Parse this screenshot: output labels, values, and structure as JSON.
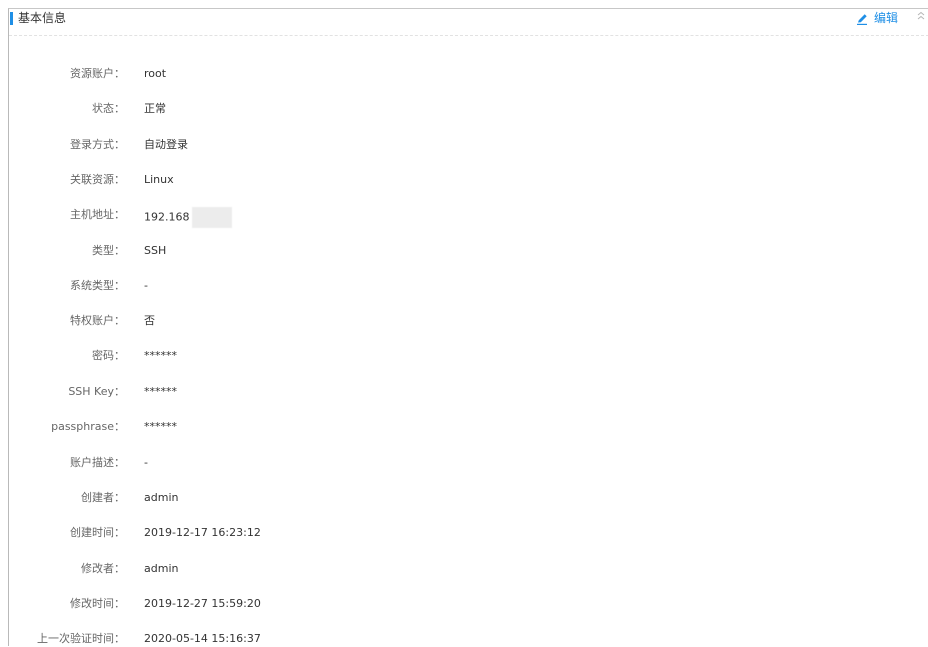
{
  "section": {
    "title": "基本信息",
    "edit_label": "编辑",
    "accent_color": "#1f8fe6",
    "icons": {
      "edit": "edit-pencil-icon",
      "collapse": "double-chevron-up-icon"
    }
  },
  "fields": [
    {
      "label": "资源账户：",
      "value": "root"
    },
    {
      "label": "状态：",
      "value": "正常"
    },
    {
      "label": "登录方式：",
      "value": "自动登录"
    },
    {
      "label": "关联资源：",
      "value": "Linux"
    },
    {
      "label": "主机地址：",
      "value": "192.168"
    },
    {
      "label": "类型：",
      "value": "SSH"
    },
    {
      "label": "系统类型：",
      "value": "-"
    },
    {
      "label": "特权账户：",
      "value": "否"
    },
    {
      "label": "密码：",
      "value": "******"
    },
    {
      "label": "SSH Key：",
      "value": "******"
    },
    {
      "label": "passphrase：",
      "value": "******"
    },
    {
      "label": "账户描述：",
      "value": "-"
    },
    {
      "label": "创建者：",
      "value": "admin"
    },
    {
      "label": "创建时间：",
      "value": "2019-12-17 16:23:12"
    },
    {
      "label": "修改者：",
      "value": "admin"
    },
    {
      "label": "修改时间：",
      "value": "2019-12-27 15:59:20"
    },
    {
      "label": "上一次验证时间：",
      "value": "2020-05-14 15:16:37"
    }
  ]
}
